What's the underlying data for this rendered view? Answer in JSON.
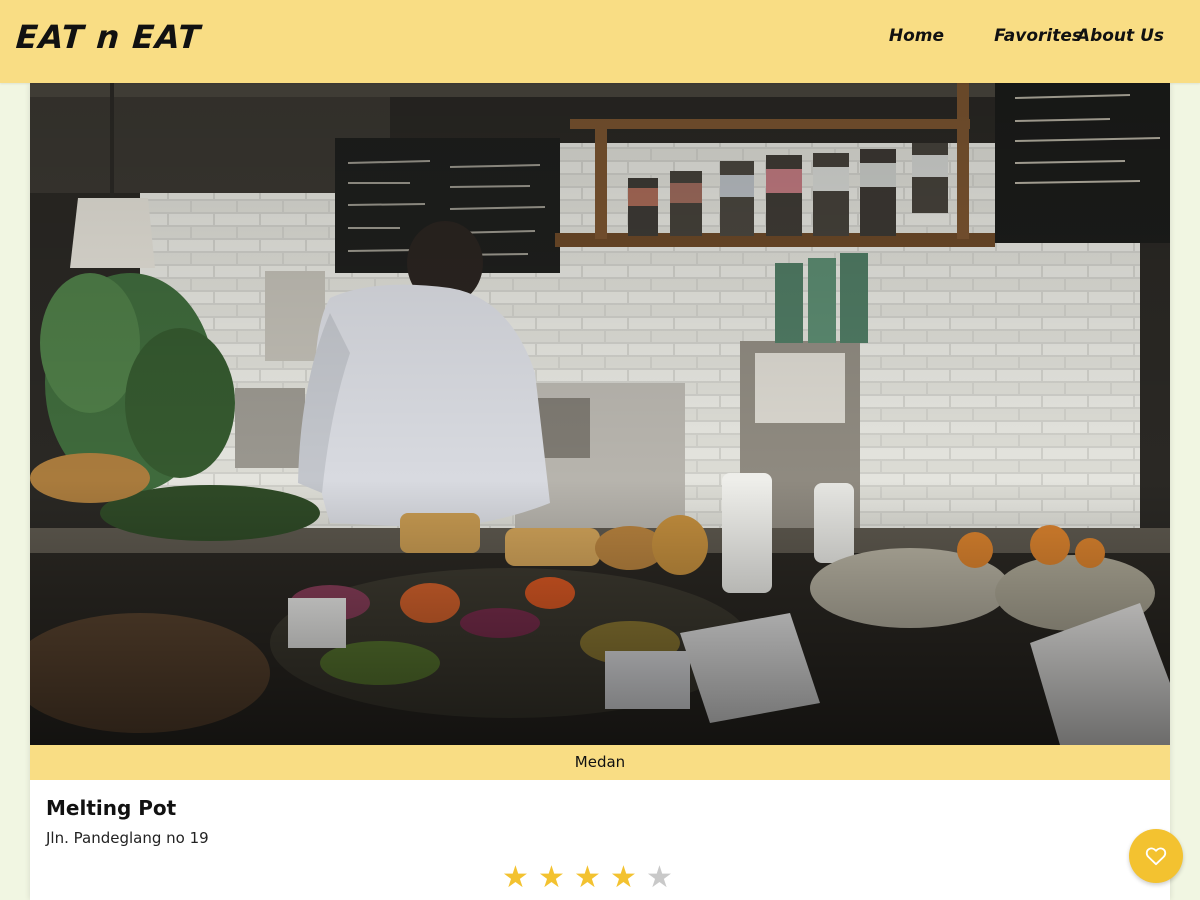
{
  "header": {
    "logo": "EAT n EAT",
    "nav": [
      {
        "label": "Home"
      },
      {
        "label": "Favorites"
      },
      {
        "label": "About Us"
      }
    ]
  },
  "restaurant": {
    "image_icon": "cafe-counter-photo",
    "city": "Medan",
    "name": "Melting Pot",
    "address": "Jln. Pandeglang no 19",
    "rating": 4,
    "rating_max": 5,
    "star_glyph": "★"
  },
  "favorite_button": {
    "icon": "heart-icon"
  },
  "colors": {
    "header_bg": "#f9dd84",
    "page_bg": "#f1f6e2",
    "accent": "#f3c230",
    "star_off": "#c9c9c9"
  }
}
